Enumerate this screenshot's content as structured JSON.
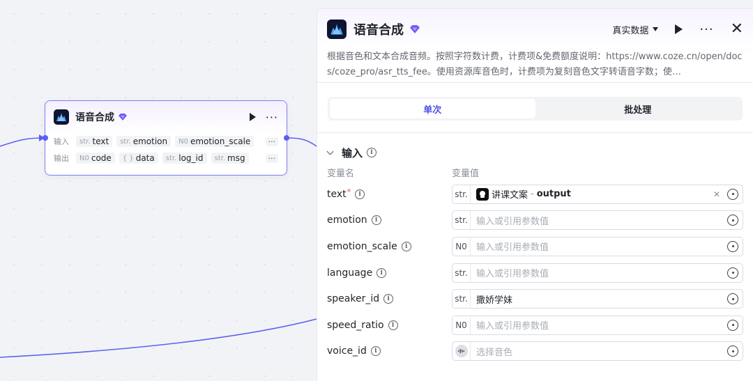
{
  "node": {
    "title": "语音合成",
    "input_label": "输入",
    "output_label": "输出",
    "inputs": [
      {
        "type": "str.",
        "name": "text"
      },
      {
        "type": "str.",
        "name": "emotion"
      },
      {
        "type": "N0",
        "name": "emotion_scale"
      }
    ],
    "outputs": [
      {
        "type": "N0",
        "name": "code"
      },
      {
        "type": "{ }",
        "name": "data"
      },
      {
        "type": "str.",
        "name": "log_id"
      },
      {
        "type": "str.",
        "name": "msg"
      }
    ],
    "more": "···"
  },
  "panel": {
    "title": "语音合成",
    "data_select": "真实数据",
    "more": "···",
    "close": "✕",
    "description": "根据音色和文本合成音频。按照字符数计费，计费项&免费额度说明：https://www.coze.cn/open/docs/coze_pro/asr_tts_fee。使用资源库音色时，计费项为复刻音色文字转语音字数；使…",
    "tabs": [
      {
        "label": "单次",
        "active": true
      },
      {
        "label": "批处理",
        "active": false
      }
    ],
    "section_title": "输入",
    "col_name": "变量名",
    "col_value": "变量值",
    "params": [
      {
        "name": "text",
        "required": true,
        "type": "str.",
        "value": "讲课文案",
        "ref_output": "output",
        "is_ref": true
      },
      {
        "name": "emotion",
        "type": "str.",
        "placeholder": "输入或引用参数值"
      },
      {
        "name": "emotion_scale",
        "type": "N0",
        "placeholder": "输入或引用参数值"
      },
      {
        "name": "language",
        "type": "str.",
        "placeholder": "输入或引用参数值"
      },
      {
        "name": "speaker_id",
        "type": "str.",
        "value": "撒娇学妹"
      },
      {
        "name": "speed_ratio",
        "type": "N0",
        "placeholder": "输入或引用参数值"
      },
      {
        "name": "voice_id",
        "type": "voice",
        "placeholder": "选择音色"
      }
    ]
  },
  "colors": {
    "accent": "#4d53e8",
    "edge": "#5b5ff0",
    "node_border": "#7c7ff2"
  }
}
